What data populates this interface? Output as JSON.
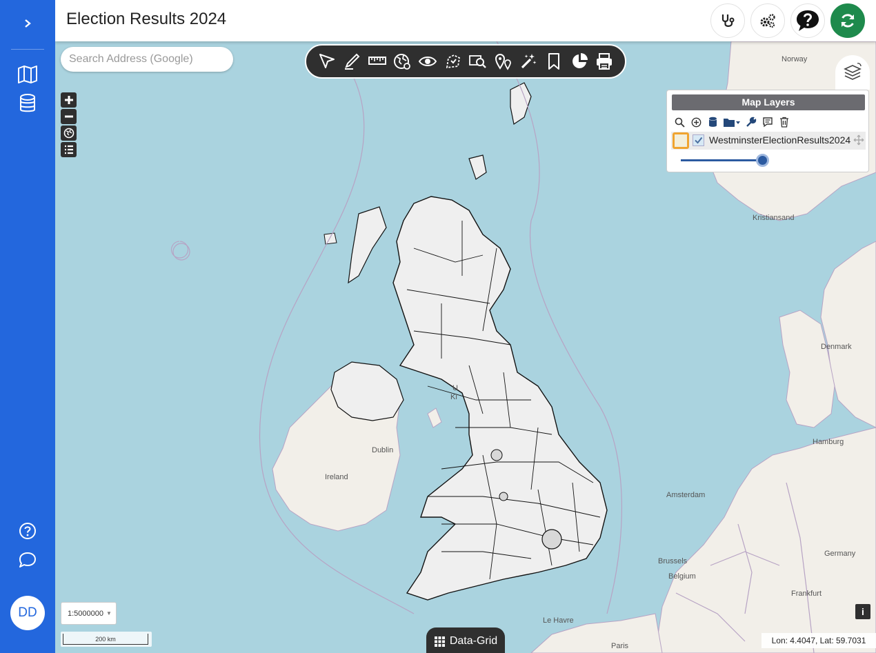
{
  "header": {
    "title": "Election Results 2024",
    "buttons": [
      {
        "name": "diagnostics",
        "icon": "stethoscope-icon"
      },
      {
        "name": "settings",
        "icon": "gears-icon"
      },
      {
        "name": "help",
        "icon": "question-bubble-icon"
      },
      {
        "name": "refresh",
        "icon": "sync-icon",
        "color": "#1e8a4c"
      }
    ]
  },
  "sidebar": {
    "expand_icon": "chevron-right-icon",
    "items": [
      {
        "name": "maps",
        "icon": "map-icon"
      },
      {
        "name": "data",
        "icon": "database-icon"
      }
    ],
    "bottom_items": [
      {
        "name": "help",
        "icon": "question-circle-icon"
      },
      {
        "name": "chat",
        "icon": "chat-bubble-icon"
      }
    ],
    "avatar_initials": "DD",
    "color": "#2367dd"
  },
  "search": {
    "placeholder": "Search Address (Google)"
  },
  "zoom_controls": [
    "zoom-in-icon",
    "zoom-out-icon",
    "globe-icon",
    "list-icon"
  ],
  "toolbar": {
    "tools": [
      "select-arrow-icon",
      "draw-pen-icon",
      "measure-ruler-icon",
      "globe-layers-icon",
      "eye-icon",
      "region-select-icon",
      "search-area-icon",
      "locations-pin-icon",
      "magic-wand-icon",
      "bookmark-icon",
      "pie-chart-icon",
      "print-icon"
    ]
  },
  "layers_panel": {
    "title": "Map Layers",
    "tools": [
      "search-icon",
      "add-icon",
      "database-icon",
      "folder-icon",
      "wrench-icon",
      "comment-icon",
      "trash-icon"
    ],
    "layers": [
      {
        "name": "WestminsterElectionResults2024",
        "visible": true,
        "fill_color": "#f3efdc",
        "opacity": 0.95
      }
    ]
  },
  "map_labels": {
    "norway": "Norway",
    "kristiansand": "Kristiansand",
    "denmark": "Denmark",
    "hamburg": "Hamburg",
    "amsterdam": "Amsterdam",
    "germany": "Germany",
    "brussels": "Brussels",
    "belgium": "Belgium",
    "frankfurt": "Frankfurt",
    "le_havre": "Le Havre",
    "paris": "Paris",
    "dublin": "Dublin",
    "ireland": "Ireland",
    "uk_partial_1": "U",
    "uk_partial_2": "Ki"
  },
  "scale": {
    "ratio": "1:5000000",
    "bar_label": "200 km"
  },
  "data_grid": {
    "label": "Data-Grid"
  },
  "coordinates": {
    "text": "Lon: 4.4047, Lat: 59.7031"
  }
}
